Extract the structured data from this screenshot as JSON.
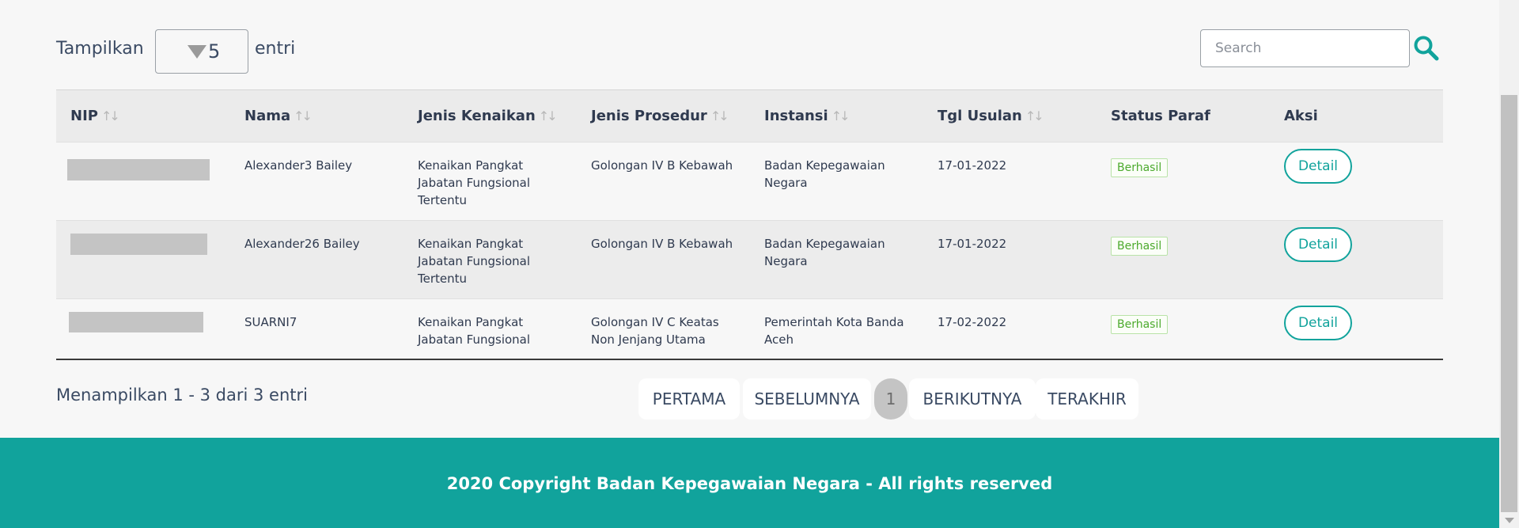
{
  "toolbar": {
    "show_label": "Tampilkan",
    "entries_value": "5",
    "entries_suffix": "entri",
    "search_placeholder": "Search"
  },
  "table": {
    "headers": [
      "NIP",
      "Nama",
      "Jenis Kenaikan",
      "Jenis Prosedur",
      "Instansi",
      "Tgl Usulan",
      "Status Paraf",
      "Aksi"
    ],
    "rows": [
      {
        "nama": "Alexander3 Bailey",
        "jenis_kenaikan": [
          "Kenaikan Pangkat",
          "Jabatan Fungsional",
          "Tertentu"
        ],
        "jenis_prosedur": [
          "Golongan IV B Kebawah"
        ],
        "instansi": [
          "Badan Kepegawaian",
          "Negara"
        ],
        "tgl_usulan": "17-01-2022",
        "status": "Berhasil",
        "aksi": "Detail"
      },
      {
        "nama": "Alexander26 Bailey",
        "jenis_kenaikan": [
          "Kenaikan Pangkat",
          "Jabatan Fungsional",
          "Tertentu"
        ],
        "jenis_prosedur": [
          "Golongan IV B Kebawah"
        ],
        "instansi": [
          "Badan Kepegawaian",
          "Negara"
        ],
        "tgl_usulan": "17-01-2022",
        "status": "Berhasil",
        "aksi": "Detail"
      },
      {
        "nama": "SUARNI7",
        "jenis_kenaikan": [
          "Kenaikan Pangkat",
          "Jabatan Fungsional"
        ],
        "jenis_prosedur": [
          "Golongan IV C Keatas",
          "Non Jenjang Utama"
        ],
        "instansi": [
          "Pemerintah Kota Banda",
          "Aceh"
        ],
        "tgl_usulan": "17-02-2022",
        "status": "Berhasil",
        "aksi": "Detail"
      }
    ]
  },
  "summary": "Menampilkan 1 - 3 dari 3 entri",
  "pagination": {
    "first": "PERTAMA",
    "prev": "SEBELUMNYA",
    "current": "1",
    "next": "BERIKUTNYA",
    "last": "TERAKHIR"
  },
  "footer": {
    "text": "2020 Copyright Badan Kepegawaian Negara - All rights reserved"
  },
  "colors": {
    "accent": "#11a39c",
    "success": "#4caa2d"
  },
  "icons": {
    "search": "search-icon",
    "sort": "sort-icon",
    "dropdown": "caret-down-icon"
  }
}
